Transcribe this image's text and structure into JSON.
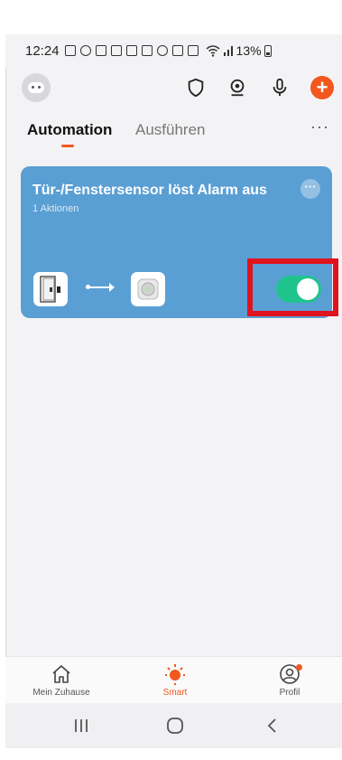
{
  "status_bar": {
    "time": "12:24",
    "battery": "13%"
  },
  "toolbar": {
    "icons": [
      "avatar",
      "shield-icon",
      "camera-icon",
      "microphone-icon",
      "add-icon"
    ]
  },
  "tabs": [
    {
      "label": "Automation",
      "active": true
    },
    {
      "label": "Ausführen",
      "active": false
    }
  ],
  "tabs_more": "···",
  "automation": {
    "title": "Tür-/Fenstersensor löst Alarm aus",
    "subtitle": "1 Aktionen",
    "more": "···",
    "trigger_device": "door-sensor-icon",
    "action_device": "alarm-siren-icon",
    "enabled": true
  },
  "bottom_nav": [
    {
      "label": "Mein Zuhause",
      "icon": "home-icon",
      "active": false
    },
    {
      "label": "Smart",
      "icon": "sun-icon",
      "active": true
    },
    {
      "label": "Profil",
      "icon": "profile-icon",
      "active": false
    }
  ],
  "colors": {
    "accent": "#f2571e",
    "card": "#5a9fd4",
    "toggle_on": "#1fc48c",
    "highlight": "#e0141e"
  }
}
